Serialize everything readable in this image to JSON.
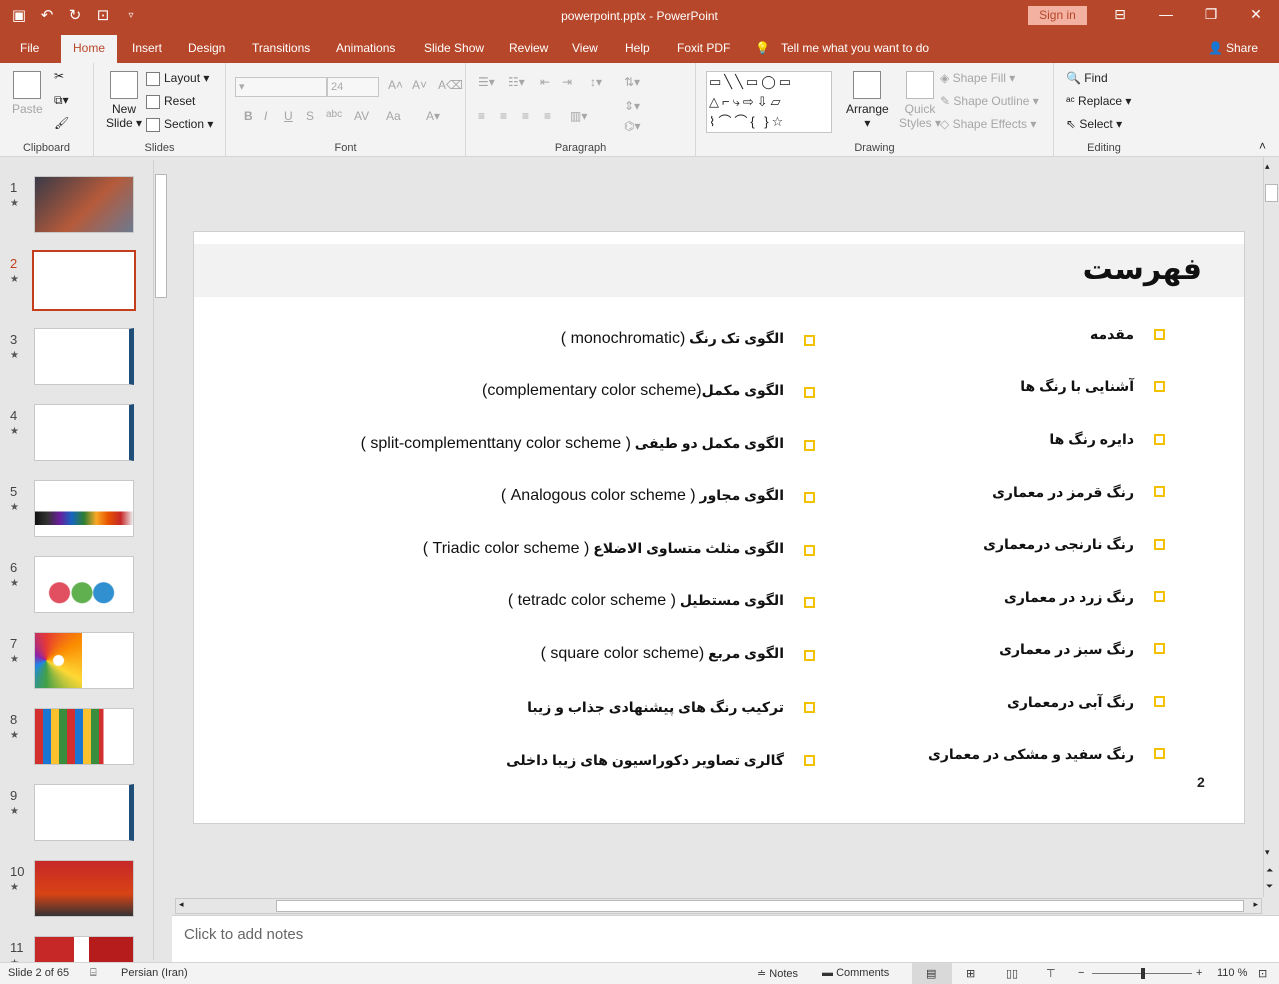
{
  "window": {
    "title": "powerpoint.pptx  -  PowerPoint",
    "signin": "Sign in"
  },
  "tabs": [
    "File",
    "Home",
    "Insert",
    "Design",
    "Transitions",
    "Animations",
    "Slide Show",
    "Review",
    "View",
    "Help",
    "Foxit PDF",
    "Tell me what you want to do",
    "Share"
  ],
  "ribbon": {
    "clipboard": {
      "label": "Clipboard",
      "paste": "Paste"
    },
    "slides": {
      "label": "Slides",
      "new_slide_1": "New",
      "new_slide_2": "Slide",
      "layout": "Layout",
      "reset": "Reset",
      "section": "Section"
    },
    "font": {
      "label": "Font",
      "size": "24"
    },
    "paragraph": {
      "label": "Paragraph"
    },
    "drawing": {
      "label": "Drawing",
      "arrange": "Arrange",
      "quick_1": "Quick",
      "quick_2": "Styles",
      "shape_fill": "Shape Fill",
      "shape_outline": "Shape Outline",
      "shape_effects": "Shape Effects"
    },
    "editing": {
      "label": "Editing",
      "find": "Find",
      "replace": "Replace",
      "select": "Select"
    }
  },
  "thumbnails": [
    "1",
    "2",
    "3",
    "4",
    "5",
    "6",
    "7",
    "8",
    "9",
    "10",
    "11"
  ],
  "slide": {
    "title": "فهرست",
    "right_items": [
      "مقدمه",
      "آشنایی با رنگ ها",
      "دایره رنگ ها",
      "رنگ قرمز در معماری",
      "رنگ نارنجی درمعماری",
      "رنگ زرد در معماری",
      "رنگ سبز در معماری",
      "رنگ آبی درمعماری",
      "رنگ سفید و مشکی در معماری"
    ],
    "left_items": [
      {
        "fa": "الگوی تک رنگ",
        "en": "(monochromatic )"
      },
      {
        "fa": "الگوی مکمل",
        "en": "(complementary color scheme)"
      },
      {
        "fa": "الگوی مکمل دو طیفی",
        "en": "( split-complementtany color scheme )"
      },
      {
        "fa": "الگوی مجاور",
        "en": "( Analogous color scheme )"
      },
      {
        "fa": "الگوی مثلث متساوی الاضلاع",
        "en": "( Triadic color scheme )"
      },
      {
        "fa": "الگوی مستطیل",
        "en": "( tetradc color scheme )"
      },
      {
        "fa": "الگوی مربع",
        "en": "(square color scheme )"
      },
      {
        "fa": "ترکیب رنگ های پیشنهادی جذاب و زیبا",
        "en": ""
      },
      {
        "fa": "گالری تصاویر دکوراسیون های زیبا داخلی",
        "en": ""
      }
    ],
    "page_number": "2"
  },
  "notes_placeholder": "Click to add notes",
  "status": {
    "slide_of": "Slide 2 of 65",
    "language": "Persian (Iran)",
    "notes": "Notes",
    "comments": "Comments",
    "zoom": "110 %"
  },
  "colors": {
    "accent": "#b7472a",
    "bullet": "#f2c200",
    "selected_thumb": "#c43e1c"
  }
}
